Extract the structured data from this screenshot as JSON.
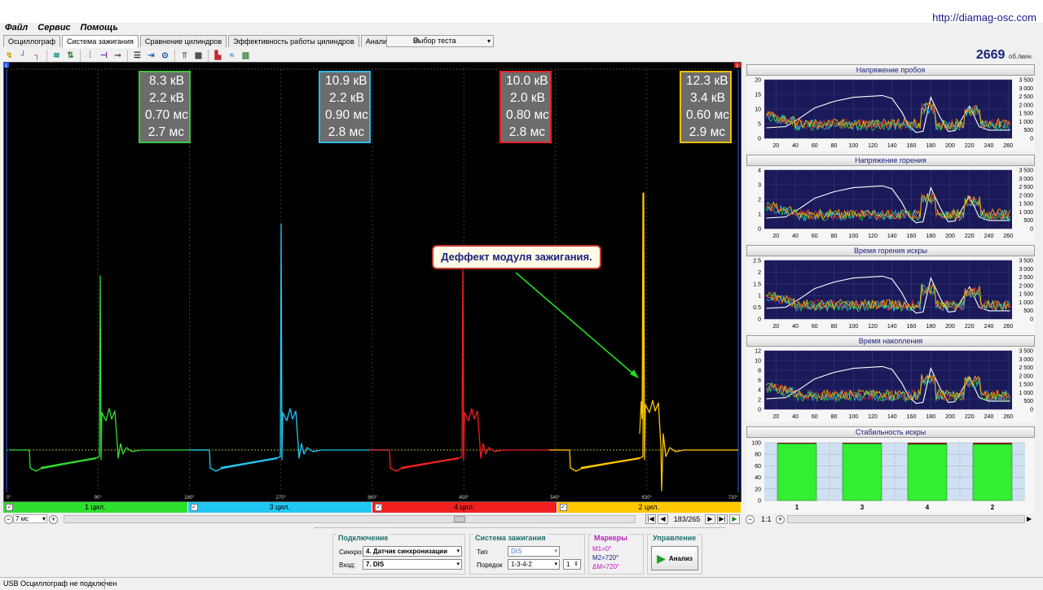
{
  "app": {
    "url": "http://diamag-osc.com",
    "rpm": "2669",
    "rpm_unit": "об./мин."
  },
  "menu": [
    "Файл",
    "Сервис",
    "Помощь"
  ],
  "tabs": [
    "Осциллограф",
    "Система зажигания",
    "Сравнение цилиндров",
    "Эффективность работы цилиндров",
    "Анализ давления в цилиндре"
  ],
  "active_tab": 1,
  "test_select": "Выбор теста",
  "toolbar_icons": [
    "sync-icon",
    "rise-edge-icon",
    "fall-edge-icon",
    "trigger-icon",
    "invert-icon",
    "scale-icon",
    "markers-icon",
    "probe-icon",
    "grid-icon",
    "measure-icon",
    "cylinders-icon",
    "report-icon",
    "overlay-icon",
    "bar-chart-icon"
  ],
  "scope": {
    "marker_left": "1",
    "marker_right": "2",
    "info_boxes": [
      {
        "cyl": "1 цил.",
        "color": "#3cc83c",
        "kv": "8.3 кВ",
        "burn_kv": "2.2 кВ",
        "burn_ms": "0.70 мс",
        "dwell_ms": "2.7 мс"
      },
      {
        "cyl": "3 цил.",
        "color": "#2fb8e8",
        "kv": "10.9 кВ",
        "burn_kv": "2.2 кВ",
        "burn_ms": "0.90 мс",
        "dwell_ms": "2.8 мс"
      },
      {
        "cyl": "4 цил.",
        "color": "#e82020",
        "kv": "10.0 кВ",
        "burn_kv": "2.0 кВ",
        "burn_ms": "0.80 мс",
        "dwell_ms": "2.8 мс"
      },
      {
        "cyl": "2 цил.",
        "color": "#f0c000",
        "kv": "12.3 кВ",
        "burn_kv": "3.4 кВ",
        "burn_ms": "0.60 мс",
        "dwell_ms": "2.9 мс"
      }
    ],
    "callout": "Деффект модуля зажигания.",
    "x_ticks": [
      "0°",
      "90°",
      "180°",
      "270°",
      "360°",
      "450°",
      "540°",
      "630°",
      "720°"
    ],
    "cylinders": [
      {
        "label": "1 цил.",
        "color": "#2ee02e",
        "checked": true
      },
      {
        "label": "3 цил.",
        "color": "#22c8f4",
        "checked": true
      },
      {
        "label": "4 цил.",
        "color": "#f02020",
        "checked": true
      },
      {
        "label": "2 цил.",
        "color": "#ffc800",
        "checked": true
      }
    ],
    "zoom": "7 мс",
    "position": "183/265"
  },
  "right_panel": {
    "x_ticks": [
      "20",
      "40",
      "60",
      "80",
      "100",
      "120",
      "140",
      "160",
      "180",
      "200",
      "220",
      "240",
      "260"
    ],
    "rpm_ticks": [
      "3 500",
      "3 000",
      "2 500",
      "2 000",
      "1 500",
      "1 000",
      "500",
      "0"
    ],
    "charts": [
      {
        "title": "Напряжение пробоя",
        "y_ticks": [
          "20",
          "15",
          "10",
          "5",
          "0"
        ]
      },
      {
        "title": "Напряжение горения",
        "y_ticks": [
          "4",
          "3",
          "2",
          "1",
          "0"
        ]
      },
      {
        "title": "Время горения искры",
        "y_ticks": [
          "2.5",
          "2",
          "1.5",
          "1",
          "0.5",
          "0"
        ]
      },
      {
        "title": "Время накопления",
        "y_ticks": [
          "12",
          "10",
          "8",
          "6",
          "4",
          "2",
          "0"
        ]
      }
    ],
    "stability": {
      "title": "Стабильность искры",
      "y_ticks": [
        "100",
        "80",
        "60",
        "40",
        "20",
        "0"
      ],
      "categories": [
        "1",
        "3",
        "4",
        "2"
      ],
      "values": [
        98,
        98,
        97,
        97
      ]
    },
    "scale": "1:1"
  },
  "chart_data": [
    {
      "type": "bar",
      "title": "Стабильность искры",
      "categories": [
        "1",
        "3",
        "4",
        "2"
      ],
      "values": [
        98,
        98,
        97,
        97
      ],
      "ylim": [
        0,
        100
      ]
    }
  ],
  "controls": {
    "connection": {
      "title": "Подключение",
      "sync_label": "Синхро:",
      "sync_value": "4.  Датчик синхронизации",
      "input_label": "Вход:",
      "input_value": "7.  DIS"
    },
    "ignition": {
      "title": "Система зажигания",
      "type_label": "Тип",
      "type_value": "DIS",
      "order_label": "Порядок",
      "order_value": "1-3-4-2",
      "order_num": "1"
    },
    "markers": {
      "title": "Маркеры",
      "m1": "M1=0°",
      "m2": "M2=720°",
      "dm": "ΔM=720°"
    },
    "control": {
      "title": "Управление",
      "analyze": "Анализ"
    }
  },
  "status": "USB Осциллограф не подключен"
}
